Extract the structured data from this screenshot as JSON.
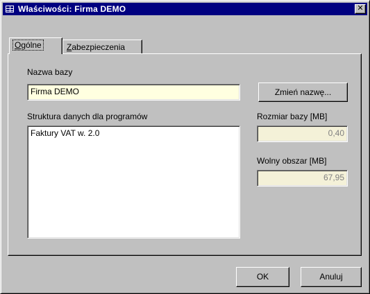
{
  "window": {
    "title": "Właściwości: Firma DEMO",
    "close_label": "✕"
  },
  "tabs": [
    {
      "mnemonic": "O",
      "rest": "gólne",
      "active": true
    },
    {
      "mnemonic": "Z",
      "rest": "abezpieczenia",
      "active": false
    }
  ],
  "general": {
    "db_name_label": "Nazwa bazy",
    "db_name_value": "Firma DEMO",
    "rename_button": "Zmień nazwę...",
    "structures_label": "Struktura danych dla programów",
    "structures": [
      "Faktury VAT w. 2.0"
    ],
    "db_size_label": "Rozmiar bazy [MB]",
    "db_size_value": "0,40",
    "free_space_label": "Wolny obszar [MB]",
    "free_space_value": "67,95"
  },
  "footer": {
    "ok": "OK",
    "cancel": "Anuluj"
  },
  "colors": {
    "titlebar": "#000080",
    "field_bg": "#ffffe0",
    "face": "#c0c0c0"
  }
}
